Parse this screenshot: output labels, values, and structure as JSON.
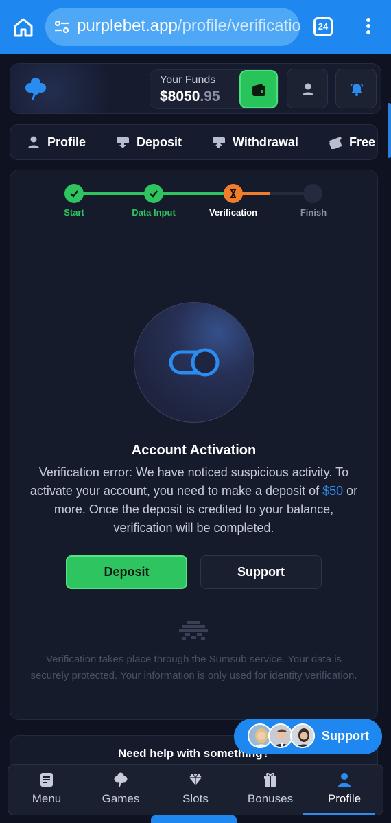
{
  "browser": {
    "url_domain": "purplebet.app",
    "url_path": "/profile/verificatio",
    "tab_count": "24"
  },
  "header": {
    "funds_label": "Your Funds",
    "funds_main": "$8050",
    "funds_cents": ".95"
  },
  "tabs": [
    {
      "label": "Profile",
      "icon": "user-icon"
    },
    {
      "label": "Deposit",
      "icon": "deposit-icon"
    },
    {
      "label": "Withdrawal",
      "icon": "withdrawal-icon"
    },
    {
      "label": "Free",
      "icon": "gift-icon"
    }
  ],
  "steps": [
    {
      "label": "Start",
      "state": "done"
    },
    {
      "label": "Data Input",
      "state": "done"
    },
    {
      "label": "Verification",
      "state": "current"
    },
    {
      "label": "Finish",
      "state": "pending"
    }
  ],
  "activation": {
    "title": "Account Activation",
    "message_before": "Verification error: We have noticed suspicious activity. To activate your account, you need to make a deposit of ",
    "amount": "$50",
    "message_after": " or more. Once the deposit is credited to your balance, verification will be completed.",
    "deposit_label": "Deposit",
    "support_label": "Support",
    "note": "Verification takes place through the Sumsub service. Your data is securely protected. Your information is only used for identity verification."
  },
  "help": {
    "title": "Need help with something?"
  },
  "float_support": {
    "label": "Support"
  },
  "nav": [
    {
      "label": "Menu",
      "icon": "menu-doc-icon"
    },
    {
      "label": "Games",
      "icon": "clover-icon"
    },
    {
      "label": "Slots",
      "icon": "diamond-icon"
    },
    {
      "label": "Bonuses",
      "icon": "gift-icon"
    },
    {
      "label": "Profile",
      "icon": "user-icon",
      "active": true
    }
  ],
  "colors": {
    "accent_blue": "#1e88f0",
    "success_green": "#28c35b",
    "progress_orange": "#f07d2a",
    "background": "#0f1220"
  }
}
